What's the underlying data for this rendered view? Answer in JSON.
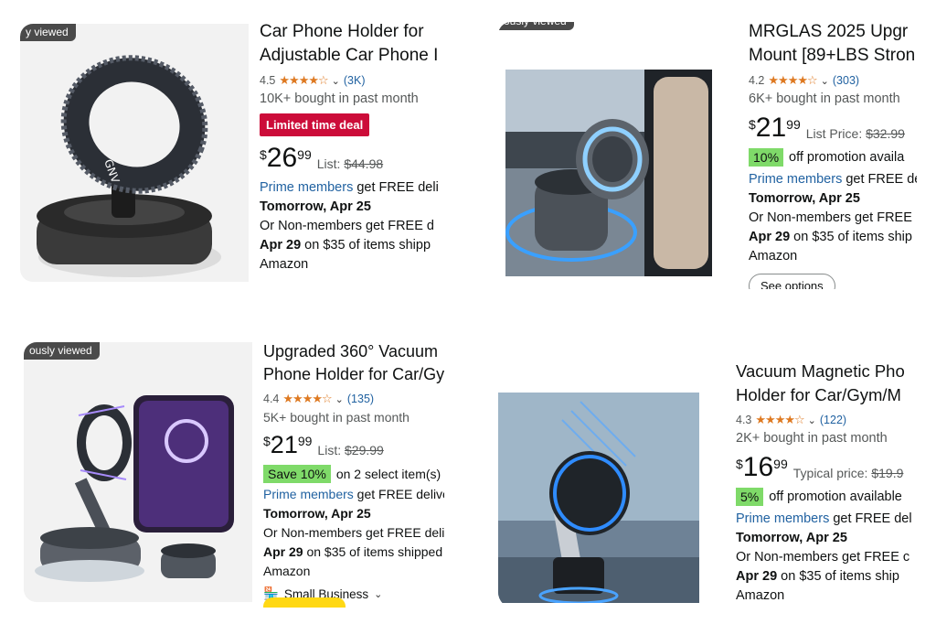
{
  "cards": [
    {
      "badge": "y viewed",
      "title1": "Car Phone Holder for",
      "title2": "Adjustable Car Phone I",
      "rating": "4.5",
      "stars": "★★★★☆",
      "reviews": "(3K)",
      "bought": "10K+ bought in past month",
      "deal": "Limited time deal",
      "currency": "$",
      "price_whole": "26",
      "price_frac": "99",
      "list_label": "List:",
      "list_price": "$44.98",
      "prime_link": "Prime members",
      "prime_text": " get FREE deli",
      "day1": "Tomorrow, Apr 25",
      "nonmembers": "Or Non-members get FREE d",
      "day2": "Apr 29",
      "day2_text": " on $35 of items shipp",
      "seller": "Amazon"
    },
    {
      "badge": "ously viewed",
      "title1": "MRGLAS 2025 Upgr",
      "title2": "Mount [89+LBS Stron",
      "rating": "4.2",
      "stars": "★★★★☆",
      "reviews": "(303)",
      "bought": "6K+ bought in past month",
      "currency": "$",
      "price_whole": "21",
      "price_frac": "99",
      "list_label": "List Price:",
      "list_price": "$32.99",
      "promo": "10%",
      "promo_text": "off promotion availa",
      "prime_link": "Prime members",
      "prime_text": " get FREE de",
      "day1": "Tomorrow, Apr 25",
      "nonmembers": "Or Non-members get FREE",
      "day2": "Apr 29",
      "day2_text": " on $35 of items ship",
      "seller": "Amazon",
      "button": "See options"
    },
    {
      "badge": "ously viewed",
      "title1": "Upgraded 360° Vacuum",
      "title2": "Phone Holder for Car/Gy",
      "rating": "4.4",
      "stars": "★★★★☆",
      "reviews": "(135)",
      "bought": "5K+ bought in past month",
      "currency": "$",
      "price_whole": "21",
      "price_frac": "99",
      "list_label": "List:",
      "list_price": "$29.99",
      "promo": "Save 10%",
      "promo_text": "on 2 select item(s)",
      "prime_link": "Prime members",
      "prime_text": " get FREE delive",
      "day1": "Tomorrow, Apr 25",
      "nonmembers": "Or Non-members get FREE deli",
      "day2": "Apr 29",
      "day2_text": " on $35 of items shipped",
      "seller": "Amazon",
      "small_business": "Small Business"
    },
    {
      "title1": "Vacuum Magnetic Pho",
      "title2": "Holder for Car/Gym/M",
      "rating": "4.3",
      "stars": "★★★★☆",
      "reviews": "(122)",
      "bought": "2K+ bought in past month",
      "currency": "$",
      "price_whole": "16",
      "price_frac": "99",
      "list_label": "Typical price:",
      "list_price": "$19.9",
      "promo": "5%",
      "promo_text": "off promotion available",
      "prime_link": "Prime members",
      "prime_text": " get FREE del",
      "day1": "Tomorrow, Apr 25",
      "nonmembers": "Or Non-members get FREE c",
      "day2": "Apr 29",
      "day2_text": " on $35 of items ship",
      "seller": "Amazon"
    }
  ],
  "colors": {
    "deal_red": "#cc0c39",
    "promo_green": "#7fda69",
    "link_blue": "#2162a1",
    "star_orange": "#de7921"
  }
}
